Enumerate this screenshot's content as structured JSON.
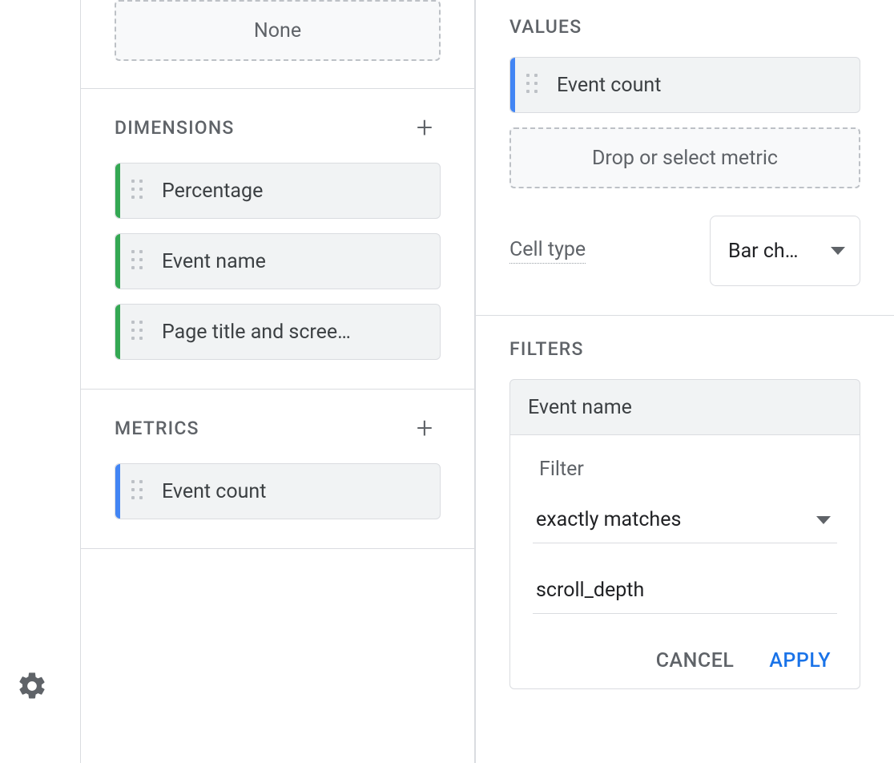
{
  "left": {
    "none_label": "None",
    "dimensions": {
      "title": "Dimensions",
      "items": [
        "Percentage",
        "Event name",
        "Page title and scree…"
      ]
    },
    "metrics": {
      "title": "Metrics",
      "items": [
        "Event count"
      ]
    }
  },
  "right": {
    "values": {
      "title": "Values",
      "items": [
        "Event count"
      ],
      "drop_hint": "Drop or select metric"
    },
    "cell_type": {
      "label": "Cell type",
      "value": "Bar ch…"
    },
    "filters": {
      "title": "Filters",
      "field": "Event name",
      "panel_title": "Filter",
      "match_type": "exactly matches",
      "value": "scroll_depth",
      "cancel": "CANCEL",
      "apply": "APPLY"
    }
  }
}
